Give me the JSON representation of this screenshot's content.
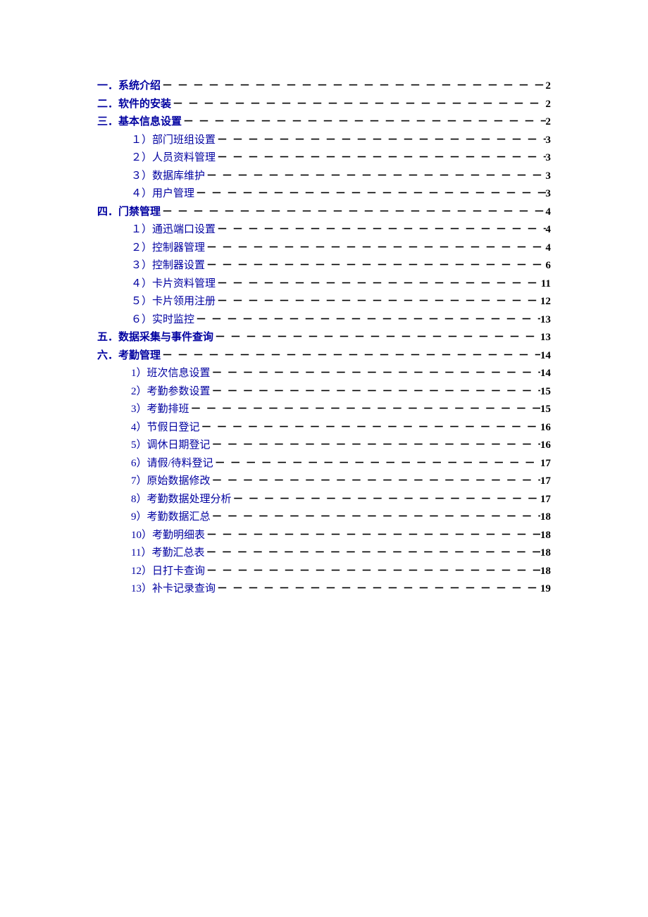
{
  "dot_fill": "－－－－－－－－－－－－－－－－－－－－－－－－－－－－－－－－－－－－－－－－－－－－",
  "toc": [
    {
      "level": 1,
      "prefix": "一．",
      "title": "系统介绍",
      "page": "2"
    },
    {
      "level": 1,
      "prefix": "二．",
      "title": "软件的安装",
      "page": "2"
    },
    {
      "level": 1,
      "prefix": "三．",
      "title": "基本信息设置",
      "page": "2"
    },
    {
      "level": 2,
      "prefix": "１）",
      "title": "部门班组设置",
      "page": "3"
    },
    {
      "level": 2,
      "prefix": "２）",
      "title": "人员资料管理",
      "page": "3"
    },
    {
      "level": 2,
      "prefix": "３）",
      "title": "数据库维护",
      "page": "3"
    },
    {
      "level": 2,
      "prefix": "４）",
      "title": "用户管理",
      "page": "3"
    },
    {
      "level": 1,
      "prefix": "四．",
      "title": "门禁管理",
      "page": "4"
    },
    {
      "level": 2,
      "prefix": "１）",
      "title": "通迅端口设置",
      "page": "4"
    },
    {
      "level": 2,
      "prefix": "２）",
      "title": "控制器管理",
      "page": "4"
    },
    {
      "level": 2,
      "prefix": "３）",
      "title": "控制器设置",
      "page": "6"
    },
    {
      "level": 2,
      "prefix": "４）",
      "title": "卡片资料管理",
      "page": "11"
    },
    {
      "level": 2,
      "prefix": "５）",
      "title": "卡片领用注册",
      "page": "12"
    },
    {
      "level": 2,
      "prefix": "６）",
      "title": "实时监控",
      "page": "13"
    },
    {
      "level": 1,
      "prefix": "五．",
      "title": "数据采集与事件查询",
      "page": "13"
    },
    {
      "level": 1,
      "prefix": "六．",
      "title": "考勤管理",
      "page": "14"
    },
    {
      "level": 2,
      "prefix": "1）",
      "title": "班次信息设置",
      "page": "14"
    },
    {
      "level": 2,
      "prefix": "2）",
      "title": "考勤参数设置",
      "page": "15"
    },
    {
      "level": 2,
      "prefix": "3）",
      "title": "考勤排班",
      "page": "15"
    },
    {
      "level": 2,
      "prefix": "4）",
      "title": "节假日登记",
      "page": "16"
    },
    {
      "level": 2,
      "prefix": "5）",
      "title": "调休日期登记",
      "page": "16"
    },
    {
      "level": 2,
      "prefix": "6）",
      "title": "请假/待料登记 ",
      "page": "17"
    },
    {
      "level": 2,
      "prefix": "7）",
      "title": "原始数据修改",
      "page": "17"
    },
    {
      "level": 2,
      "prefix": "8）",
      "title": "考勤数据处理分析",
      "page": "17"
    },
    {
      "level": 2,
      "prefix": "9）",
      "title": "考勤数据汇总",
      "page": "18"
    },
    {
      "level": 2,
      "prefix": "10）",
      "title": "考勤明细表 ",
      "page": "18"
    },
    {
      "level": 2,
      "prefix": "11）",
      "title": "考勤汇总表 ",
      "page": "18"
    },
    {
      "level": 2,
      "prefix": "12）",
      "title": "日打卡查询 ",
      "page": "18"
    },
    {
      "level": 2,
      "prefix": "13）",
      "title": "补卡记录查询 ",
      "page": "19"
    }
  ]
}
